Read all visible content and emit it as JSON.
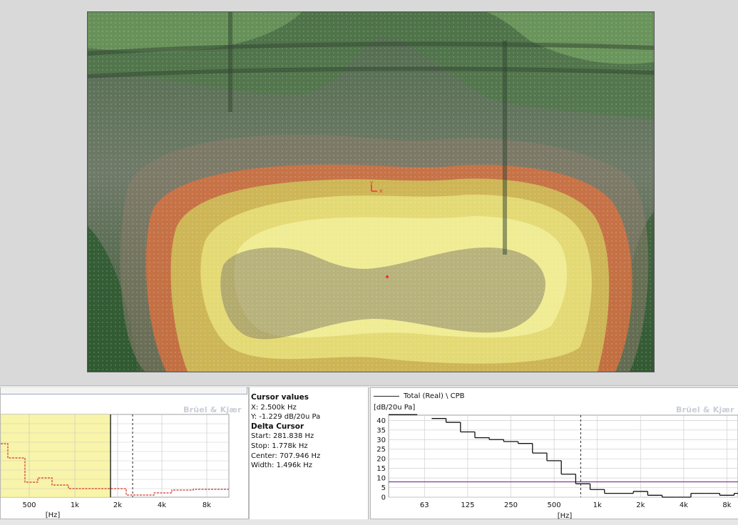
{
  "cursor_values": {
    "title": "Cursor values",
    "x": "X: 2.500k Hz",
    "y": "Y: -1.229 dB/20u Pa",
    "delta_title": "Delta Cursor",
    "start": "Start: 281.838 Hz",
    "stop": "Stop: 1.778k Hz",
    "center": "Center: 707.946 Hz",
    "width": "Width: 1.496k Hz"
  },
  "brand": "Brüel & Kjær",
  "left_chart": {
    "xlabel": "[Hz]",
    "ticks": [
      "500",
      "1k",
      "2k",
      "4k",
      "8k"
    ]
  },
  "right_chart": {
    "legend": "Total (Real) \\ CPB",
    "ylabel": "[dB/20u Pa]",
    "xlabel": "[Hz]",
    "xticks": [
      "63",
      "125",
      "250",
      "500",
      "1k",
      "2k",
      "4k",
      "8k"
    ],
    "yticks": [
      "40",
      "35",
      "30",
      "25",
      "20",
      "15",
      "10",
      "5",
      "0"
    ]
  },
  "colors": {
    "selection_fill": "#f7f29a",
    "trace": "#111111",
    "red_trace": "#d2362a",
    "threshold": "#7a3f9a"
  },
  "chart_data": {
    "type": "line",
    "title": "",
    "xlabel": "[Hz]",
    "ylabel": "[dB/20u Pa]",
    "ylim": [
      0,
      42
    ],
    "grid": true,
    "legend": "top-left",
    "series": [
      {
        "name": "Total (Real) \\ CPB",
        "x": [
          "50",
          "63",
          "80",
          "100",
          "125",
          "160",
          "200",
          "250",
          "315",
          "400",
          "500",
          "630",
          "800",
          "1k",
          "1.25k",
          "1.6k",
          "2k",
          "2.5k",
          "3.15k",
          "4k",
          "5k",
          "6.3k",
          "8k",
          "10k"
        ],
        "values": [
          43,
          43,
          41,
          39,
          34,
          31,
          30,
          29,
          28,
          23,
          19,
          12,
          7,
          4,
          2,
          2,
          3,
          1,
          0,
          0,
          2,
          2,
          1,
          2
        ]
      }
    ],
    "threshold": 8,
    "cursor_x": "1.778k"
  }
}
